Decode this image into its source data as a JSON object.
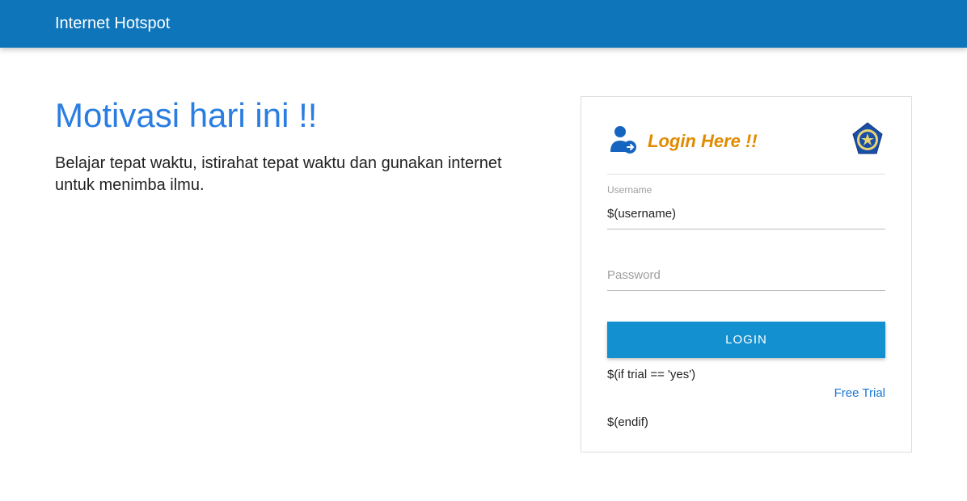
{
  "header": {
    "title": "Internet Hotspot"
  },
  "motivation": {
    "title": "Motivasi hari ini !!",
    "text": "Belajar tepat waktu, istirahat tepat waktu dan gunakan internet untuk menimba ilmu."
  },
  "login": {
    "title": "Login Here !!",
    "username_label": "Username",
    "username_value": "$(username)",
    "password_placeholder": "Password",
    "password_value": "",
    "button_label": "LOGIN",
    "trial_if": "$(if trial == 'yes')",
    "free_trial_label": "Free Trial",
    "trial_endif": "$(endif)"
  }
}
